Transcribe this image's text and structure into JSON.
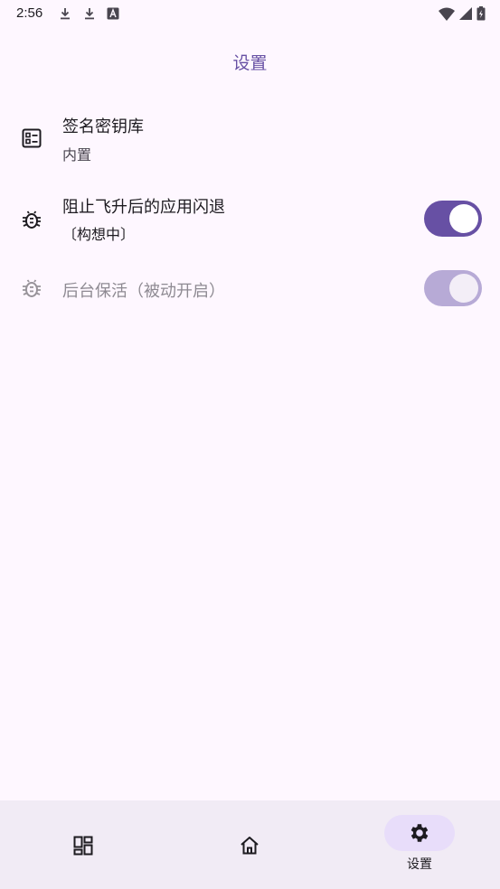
{
  "status_bar": {
    "time": "2:56",
    "left_icons": [
      "download-icon",
      "download-icon",
      "font-icon"
    ],
    "right_icons": [
      "wifi-icon",
      "signal-icon",
      "battery-charging-icon"
    ]
  },
  "page": {
    "title": "设置"
  },
  "settings": {
    "keystore": {
      "icon": "keystore-icon",
      "title": "签名密钥库",
      "subtitle": "内置"
    },
    "prevent_crash": {
      "icon": "bug-icon",
      "title": "阻止飞升后的应用闪退",
      "subtitle": "〔构想中〕",
      "enabled": true
    },
    "keep_alive": {
      "icon": "bug-icon",
      "title": "后台保活（被动开启）",
      "enabled": true,
      "disabled": true
    }
  },
  "bottom_nav": {
    "items": [
      {
        "icon": "dashboard-icon",
        "label": "",
        "active": false
      },
      {
        "icon": "home-icon",
        "label": "",
        "active": false
      },
      {
        "icon": "gear-icon",
        "label": "设置",
        "active": true
      }
    ]
  },
  "colors": {
    "background": "#FEF7FF",
    "accent": "#6750A4",
    "nav_background": "#F1EBF5",
    "nav_active_indicator": "#E8DDFA"
  }
}
